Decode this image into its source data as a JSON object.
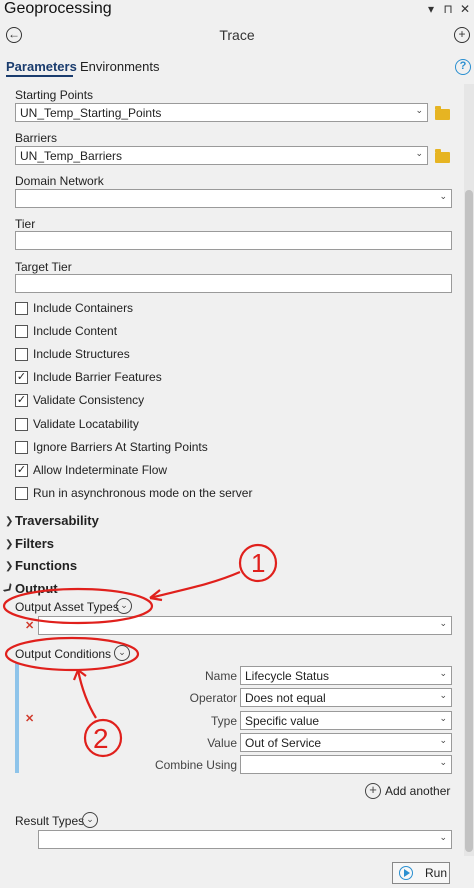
{
  "window": {
    "title": "Geoprocessing",
    "tool_title": "Trace",
    "controls": [
      "▾",
      "⊓",
      "✕"
    ]
  },
  "tabs": [
    {
      "label": "Parameters",
      "active": true
    },
    {
      "label": "Environments",
      "active": false
    }
  ],
  "help_glyph": "?",
  "params": {
    "starting_points": {
      "label": "Starting Points",
      "value": "UN_Temp_Starting_Points"
    },
    "barriers": {
      "label": "Barriers",
      "value": "UN_Temp_Barriers"
    },
    "domain_network": {
      "label": "Domain Network",
      "value": ""
    },
    "tier": {
      "label": "Tier",
      "value": ""
    },
    "target_tier": {
      "label": "Target Tier",
      "value": ""
    }
  },
  "checkboxes": [
    {
      "label": "Include Containers",
      "checked": false
    },
    {
      "label": "Include Content",
      "checked": false
    },
    {
      "label": "Include Structures",
      "checked": false
    },
    {
      "label": "Include Barrier Features",
      "checked": true
    },
    {
      "label": "Validate Consistency",
      "checked": true
    },
    {
      "label": "Validate Locatability",
      "checked": false
    },
    {
      "label": "Ignore Barriers At Starting Points",
      "checked": false
    },
    {
      "label": "Allow Indeterminate Flow",
      "checked": true
    },
    {
      "label": "Run in asynchronous mode on the server",
      "checked": false
    }
  ],
  "sections": {
    "traversability": "Traversability",
    "filters": "Filters",
    "functions": "Functions",
    "output": "Output"
  },
  "output": {
    "asset_types_label": "Output Asset Types",
    "conditions_label": "Output Conditions",
    "condition_rows": [
      {
        "label": "Name",
        "value": "Lifecycle Status"
      },
      {
        "label": "Operator",
        "value": "Does not equal"
      },
      {
        "label": "Type",
        "value": "Specific value"
      },
      {
        "label": "Value",
        "value": "Out of Service"
      },
      {
        "label": "Combine Using",
        "value": ""
      }
    ],
    "add_another": "Add another",
    "result_types_label": "Result Types"
  },
  "run_label": "Run",
  "annotations": {
    "one": "1",
    "two": "2",
    "color": "#e0201c"
  },
  "colors": {
    "accent": "#1a3c6e",
    "help": "#2a8fd0",
    "folder": "#e6b422",
    "error_x": "#d0392b",
    "condition_bar": "#8ec4ea"
  }
}
